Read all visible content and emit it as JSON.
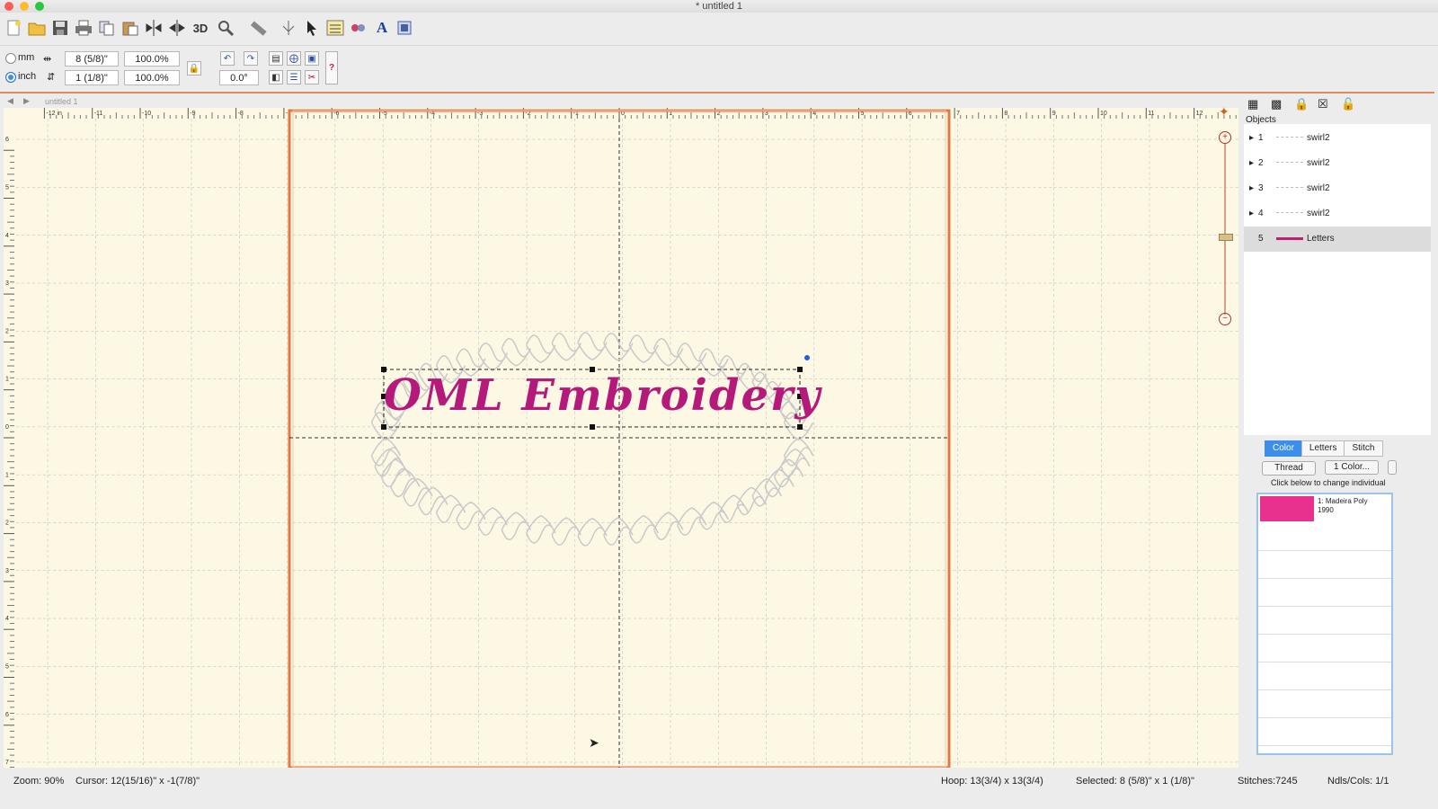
{
  "window": {
    "title": "* untitled 1"
  },
  "toolbar": {
    "icons": [
      "new-file-icon",
      "open-folder-icon",
      "save-icon",
      "print-icon",
      "copy-icon",
      "paste-icon",
      "mirror-horizontal-icon",
      "mirror-vertical-icon",
      "3d-label",
      "zoom-icon",
      "ruler-icon",
      "stitch-point-icon",
      "pointer-icon",
      "grid-icon",
      "color-stitch-icon",
      "text-tool-icon",
      "layout-icon"
    ],
    "three_d_label": "3D",
    "text_tool_label": "A"
  },
  "properties": {
    "unit_mm_label": "mm",
    "unit_inch_label": "inch",
    "selected_unit": "inch",
    "width_value": "8 (5/8)\"",
    "height_value": "1 (1/8)\"",
    "width_scale": "100.0%",
    "height_scale": "100.0%",
    "rotation_value": "0.0°"
  },
  "canvas": {
    "tab_label": "untitled 1",
    "ruler_top": [
      "-12 in",
      "-11",
      "-10",
      "-9",
      "-8",
      "-7",
      "-6",
      "-5",
      "-4",
      "-3",
      "-2",
      "-1",
      "0",
      "1",
      "2",
      "3",
      "4",
      "5",
      "6",
      "7",
      "8",
      "9",
      "10",
      "11",
      "12"
    ],
    "ruler_left": [
      "6",
      "5",
      "4",
      "3",
      "2",
      "1",
      "0",
      "1",
      "2",
      "3",
      "4",
      "5",
      "6",
      "7"
    ],
    "design_text": "OML Embroidery",
    "thread_color": "#b5197a",
    "hoop_color": "#e07a45",
    "background_color": "#fdf8e4"
  },
  "objects_panel": {
    "title": "Objects",
    "rows": [
      {
        "index": "1",
        "name": "swirl2"
      },
      {
        "index": "2",
        "name": "swirl2"
      },
      {
        "index": "3",
        "name": "swirl2"
      },
      {
        "index": "4",
        "name": "swirl2"
      },
      {
        "index": "5",
        "name": "Letters"
      }
    ]
  },
  "color_panel": {
    "tabs": [
      "Color",
      "Letters",
      "Stitch"
    ],
    "active_tab": "Color",
    "thread_button": "Thread",
    "color_button": "1 Color...",
    "hint": "Click below to change individual",
    "threads": [
      {
        "swatch": "#e8318f",
        "label_line1": "1: Madeira Poly",
        "label_line2": "1990"
      }
    ]
  },
  "status": {
    "zoom": "Zoom: 90%",
    "cursor": "Cursor: 12(15/16)\" x -1(7/8)\"",
    "hoop": "Hoop: 13(3/4) x 13(3/4)",
    "selected": "Selected: 8 (5/8)\" x 1 (1/8)\"",
    "stitches": "Stitches:7245",
    "ndls": "Ndls/Cols: 1/1"
  }
}
